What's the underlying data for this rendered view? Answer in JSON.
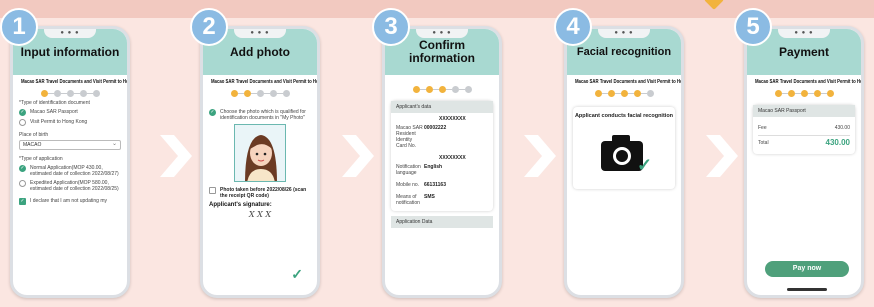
{
  "steps": [
    {
      "number": "1",
      "title": "Input information",
      "doc_title": "Macao SAR Travel Documents and Visit Permit to Hong Kong",
      "active_dot": 0,
      "fields": {
        "type_id_label": "*Type of identification document",
        "opt1": "Macao SAR Passport",
        "opt2": "Visit Permit to Hong Kong",
        "birth_label": "Place of birth",
        "birth_value": "MACAO",
        "app_type_label": "*Type of application",
        "app_opt1": "Normal Application(MOP 430.00, estimated date of collection 2022/08/27)",
        "app_opt2": "Expedited Application(MOP 580.00, estimated date of collection 2022/08/25)",
        "declare": "I declare that I am not updating my"
      }
    },
    {
      "number": "2",
      "title": "Add photo",
      "doc_title": "Macao SAR Travel Documents and Visit Permit to Hong Kong",
      "active_dot": 1,
      "fields": {
        "choose": "Choose the photo which is qualified for identification documents in \"My Photo\"",
        "taken": "Photo taken before 2022/08/26 (scan the receipt QR code)",
        "signature_label": "Applicant's signature:",
        "signature": "X X X"
      }
    },
    {
      "number": "3",
      "title": "Confirm information",
      "active_dot": 2,
      "fields": {
        "card_header": "Applicant's data",
        "name1": "XXXXXXXX",
        "id_label": "Macao SAR Resident Identity Card No.",
        "id_value": "00002222",
        "name2": "XXXXXXXX",
        "notif_label": "Notification language",
        "notif_value": "English",
        "mobile_label": "Mobile no.",
        "mobile_value": "66131163",
        "means_label": "Means of notification",
        "means_value": "SMS",
        "app_data": "Application Data"
      }
    },
    {
      "number": "4",
      "title": "Facial recognition",
      "doc_title": "Macao SAR Travel Documents and Visit Permit to Hong Kong",
      "active_dot": 3,
      "fields": {
        "conducts": "Applicant conducts facial recognition"
      }
    },
    {
      "number": "5",
      "title": "Payment",
      "doc_title": "Macao SAR Travel Documents and Visit Permit to Hong Kong",
      "active_dot": 4,
      "fields": {
        "card_header": "Macao SAR Passport",
        "fee_label": "Fee",
        "fee_value": "430.00",
        "total_label": "Total",
        "total_value": "430.00",
        "pay_button": "Pay now"
      }
    }
  ],
  "colors": {
    "header": "#a8d9d1",
    "accent_green": "#4fa07b",
    "progress_active": "#f2b33d",
    "bubble": "#8bbbe3",
    "background": "#fbe6e1"
  }
}
